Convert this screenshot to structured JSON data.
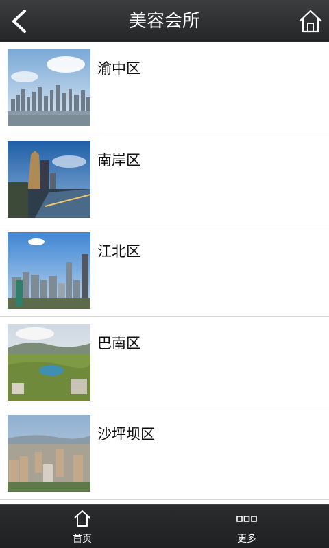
{
  "header": {
    "title": "美容会所",
    "back_icon": "back-chevron-icon",
    "home_icon": "home-icon"
  },
  "districts": [
    {
      "name": "渝中区"
    },
    {
      "name": "南岸区"
    },
    {
      "name": "江北区"
    },
    {
      "name": "巴南区"
    },
    {
      "name": "沙坪坝区"
    }
  ],
  "tabbar": {
    "items": [
      {
        "label": "首页",
        "icon": "home-outline-icon"
      },
      {
        "label": "更多",
        "icon": "more-squares-icon"
      }
    ]
  }
}
